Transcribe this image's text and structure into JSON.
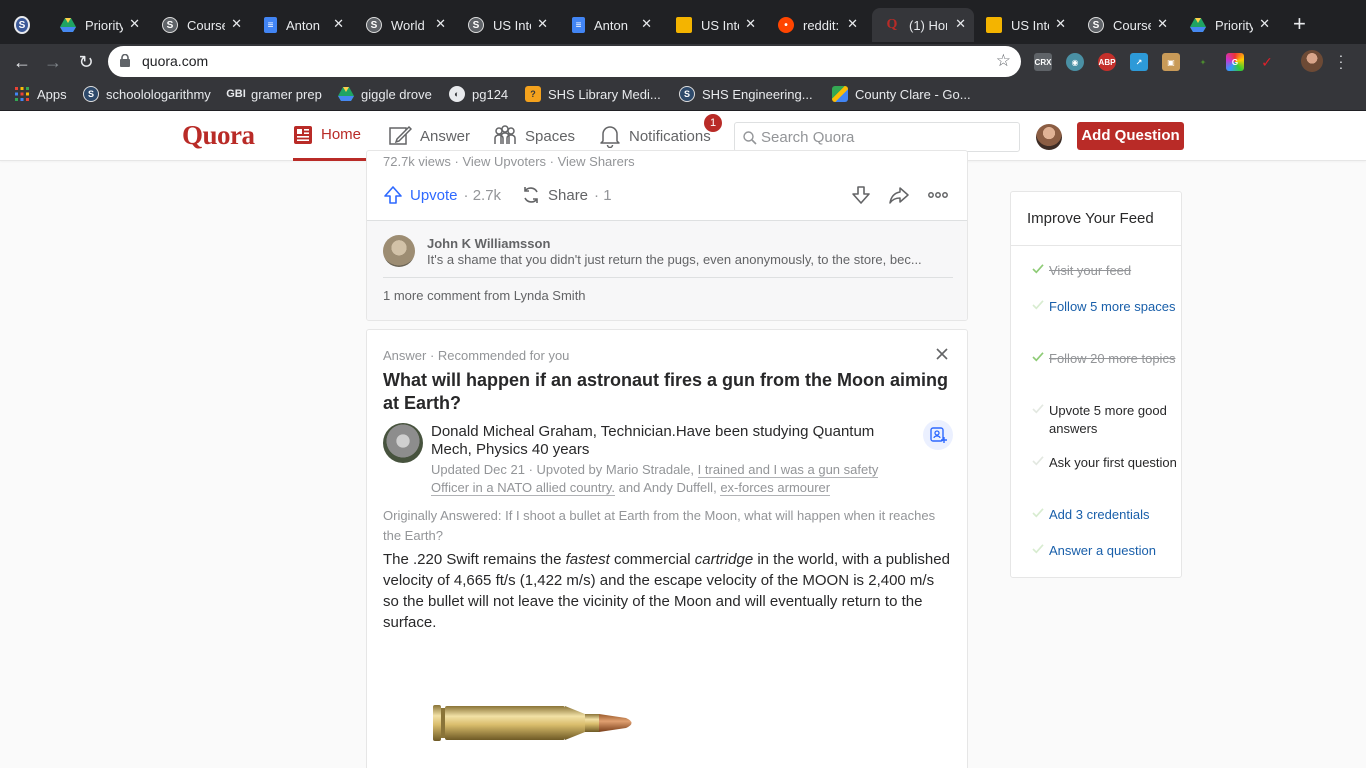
{
  "browser": {
    "tabs": [
      {
        "title": "",
        "icon": "quora-s-icon",
        "color": "#3b5998"
      },
      {
        "title": "Priority",
        "icon": "google-drive-icon",
        "color": "#1fa463"
      },
      {
        "title": "Course",
        "icon": "schoology-icon",
        "color": "#5f6368"
      },
      {
        "title": "Anton",
        "icon": "google-docs-icon",
        "color": "#4285f4"
      },
      {
        "title": "World",
        "icon": "schoology-icon",
        "color": "#5f6368"
      },
      {
        "title": "US Inte",
        "icon": "schoology-icon",
        "color": "#5f6368"
      },
      {
        "title": "Anton",
        "icon": "google-docs-icon",
        "color": "#4285f4"
      },
      {
        "title": "US Inte",
        "icon": "google-slides-icon",
        "color": "#f4b400"
      },
      {
        "title": "reddit:",
        "icon": "reddit-icon",
        "color": "#ff4500"
      },
      {
        "title": "(1) Hon",
        "icon": "quora-icon",
        "color": "#b92b27"
      },
      {
        "title": "US Inte",
        "icon": "google-slides-icon",
        "color": "#f4b400"
      },
      {
        "title": "Course",
        "icon": "schoology-icon",
        "color": "#5f6368"
      },
      {
        "title": "Priority",
        "icon": "google-drive-icon",
        "color": "#1fa463"
      }
    ],
    "url": "quora.com",
    "bookmarks": [
      {
        "label": "Apps",
        "icon": "apps-grid-icon"
      },
      {
        "label": "schoolologarithmy",
        "icon": "schoology-icon"
      },
      {
        "label": "gramer prep",
        "icon": "gbi-icon"
      },
      {
        "label": "giggle drove",
        "icon": "google-drive-icon"
      },
      {
        "label": "pg124",
        "icon": "globe-icon"
      },
      {
        "label": "SHS Library Medi...",
        "icon": "library-icon"
      },
      {
        "label": "SHS Engineering...",
        "icon": "schoology-icon"
      },
      {
        "label": "County Clare - Go...",
        "icon": "google-maps-icon"
      }
    ]
  },
  "header": {
    "logo": "Quora",
    "nav": {
      "home": "Home",
      "answer": "Answer",
      "spaces": "Spaces",
      "notifications": "Notifications",
      "notifications_count": "1"
    },
    "search_placeholder": "Search Quora",
    "add_question": "Add Question"
  },
  "feed": {
    "prev_card": {
      "stats": "72.7k views · View Upvoters · View Sharers",
      "upvote_label": "Upvote",
      "upvote_count": "· 2.7k",
      "share_label": "Share",
      "share_count": "· 1",
      "comment": {
        "author": "John K Williamsson",
        "text": "It's a shame that you didn't just return the pugs, even anonymously, to the store, bec..."
      },
      "more_comments": "1 more comment from Lynda Smith"
    },
    "answer_card": {
      "context": "Answer · Recommended for you",
      "question": "What will happen if an astronaut fires a gun from the Moon aiming at Earth?",
      "author_name": "Donald Micheal Graham, Technician.Have been studying Quantum Mech, Physics 40 years",
      "meta_prefix": "Updated Dec 21 · Upvoted by Mario Stradale,",
      "meta_cred1": "I trained and I was a gun safety Officer in a NATO allied country.",
      "meta_and": "and Andy Duffell,",
      "meta_cred2": "ex-forces armourer",
      "original": "Originally Answered: If I shoot a bullet at Earth from the Moon, what will happen when it reaches the Earth?",
      "body_1": "The .220 Swift remains the ",
      "body_em1": "fastest",
      "body_2": " commercial ",
      "body_em2": "cartridge",
      "body_3": " in the world, with a published velocity of 4,665 ft/s (1,422 m/s) and the escape velocity of the MOON is 2,400 m/s so the bullet will not leave the vicinity of the Moon and will eventually return to the surface."
    }
  },
  "sidebar": {
    "title": "Improve Your Feed",
    "items": [
      {
        "label": "Visit your feed",
        "state": "done"
      },
      {
        "label": "Follow 5 more spaces",
        "state": "link"
      },
      {
        "label": "Follow 20 more topics",
        "state": "done"
      },
      {
        "label": "Upvote 5 more good answers",
        "state": "plain"
      },
      {
        "label": "Ask your first question",
        "state": "plain"
      },
      {
        "label": "Add 3 credentials",
        "state": "link"
      },
      {
        "label": "Answer a question",
        "state": "link"
      }
    ]
  },
  "colors": {
    "brand": "#b92b27",
    "link": "#195faa",
    "upvote": "#2e69ff",
    "check_green": "#8ecb76"
  }
}
